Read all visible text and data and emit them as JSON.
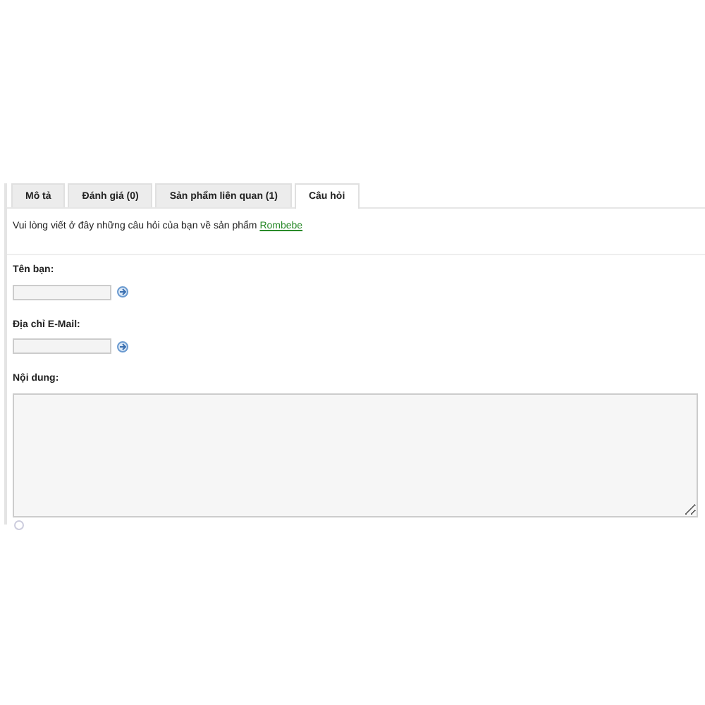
{
  "tabs": [
    {
      "label": "Mô tả",
      "selected": false
    },
    {
      "label": "Đánh giá (0)",
      "selected": false
    },
    {
      "label": "Sản phẩm liên quan (1)",
      "selected": false
    },
    {
      "label": "Câu hỏi",
      "selected": true
    }
  ],
  "intro": {
    "text": "Vui lòng viết ở đây những câu hỏi của bạn về sản phẩm",
    "link": "Rombebe"
  },
  "fields": [
    {
      "label": "Tên bạn:",
      "kind": "input"
    },
    {
      "label": "Địa chỉ E-Mail:",
      "kind": "input"
    },
    {
      "label": "Nội dung:",
      "kind": "textarea"
    }
  ]
}
